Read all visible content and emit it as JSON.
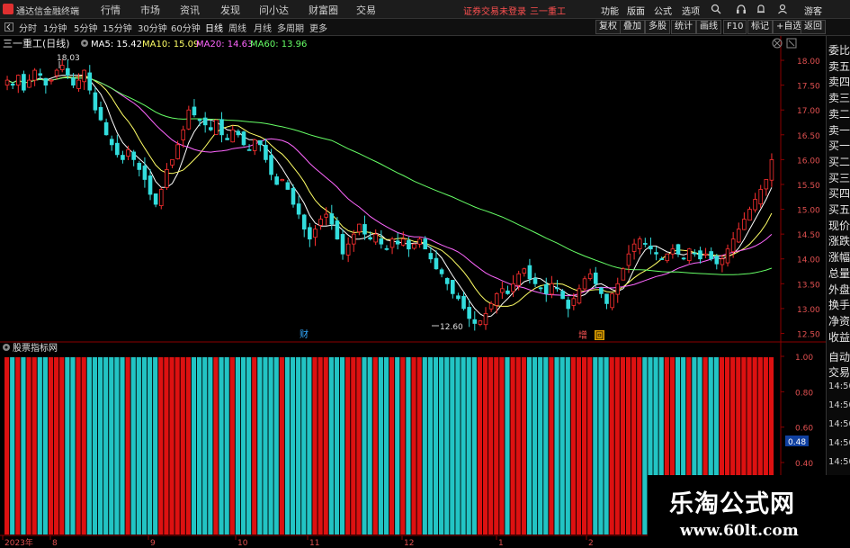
{
  "app": {
    "title": "通达信金融终端",
    "menu": [
      "行情",
      "市场",
      "资讯",
      "发现",
      "问小达",
      "财富圈",
      "交易"
    ],
    "warning": "证券交易未登录",
    "stock_name": "三一重工",
    "right_menu": [
      "功能",
      "版面",
      "公式",
      "选项"
    ],
    "guest": "游客"
  },
  "period_bar": {
    "periods": [
      "分时",
      "1分钟",
      "5分钟",
      "15分钟",
      "30分钟",
      "60分钟",
      "日线",
      "周线",
      "月线",
      "多周期",
      "更多"
    ],
    "active": "日线",
    "tools": [
      "复权",
      "叠加",
      "多股",
      "统计",
      "画线",
      "F10",
      "标记",
      "+自选",
      "返回"
    ]
  },
  "kline": {
    "title": "三一重工(日线)",
    "ma": [
      {
        "label": "MA5: 15.42",
        "color": "#ffffff"
      },
      {
        "label": "MA10: 15.09",
        "color": "#ffff66"
      },
      {
        "label": "MA20: 14.63",
        "color": "#ff66ff"
      },
      {
        "label": "MA60: 13.96",
        "color": "#66ff66"
      }
    ],
    "high_label": "18.03",
    "low_label": "12.60",
    "markers": [
      "财",
      "增",
      "回"
    ],
    "ylim": [
      12.4,
      18.2
    ],
    "yticks": [
      "18.00",
      "17.50",
      "17.00",
      "16.50",
      "16.00",
      "15.50",
      "15.00",
      "14.50",
      "14.00",
      "13.50",
      "13.00",
      "12.50"
    ]
  },
  "indicator": {
    "title": "股票指标网",
    "yticks": [
      "1.00",
      "0.80",
      "0.60",
      "0.40"
    ],
    "marker_value": "0.48"
  },
  "xaxis": {
    "labels": [
      "2023年",
      "8",
      "9",
      "10",
      "11",
      "12",
      "1",
      "2"
    ]
  },
  "right_panel": {
    "quote_items": [
      "委比",
      "卖五",
      "卖四",
      "卖三",
      "卖二",
      "卖一",
      "买一",
      "买二",
      "买三",
      "买四",
      "买五",
      "现价",
      "涨跌",
      "涨幅",
      "总量",
      "外盘",
      "换手",
      "净资",
      "收益"
    ],
    "auto_label": "自动",
    "trade_label": "交易",
    "times": [
      "14:50",
      "14:50",
      "14:50",
      "14:50",
      "14:50",
      "14:50",
      "14:50",
      "14:50"
    ]
  },
  "watermark": {
    "cn": "乐淘公式网",
    "url": "www.60lt.com"
  },
  "colors": {
    "up": "#ff3030",
    "down": "#33dddd",
    "bar_red": "#dd1111",
    "bar_cyan": "#22c4c4"
  },
  "chart_data": {
    "type": "candlestick",
    "closes": [
      17.6,
      17.5,
      17.7,
      17.4,
      17.6,
      17.8,
      17.7,
      17.5,
      17.6,
      17.8,
      17.9,
      17.7,
      17.5,
      17.6,
      17.8,
      17.4,
      17.0,
      16.8,
      16.5,
      16.3,
      16.1,
      16.0,
      16.2,
      16.0,
      15.8,
      15.6,
      15.3,
      15.1,
      15.4,
      15.8,
      16.0,
      16.3,
      16.6,
      17.0,
      16.9,
      16.8,
      16.7,
      16.6,
      16.8,
      16.5,
      16.4,
      16.6,
      16.5,
      16.3,
      16.2,
      16.4,
      16.3,
      16.0,
      15.7,
      15.5,
      15.6,
      15.4,
      15.1,
      14.9,
      14.6,
      14.4,
      14.6,
      14.8,
      14.9,
      14.7,
      14.4,
      14.1,
      14.3,
      14.5,
      14.7,
      14.5,
      14.4,
      14.5,
      14.3,
      14.2,
      14.4,
      14.3,
      14.4,
      14.2,
      14.3,
      14.4,
      14.2,
      14.0,
      13.8,
      13.7,
      13.5,
      13.3,
      13.2,
      13.0,
      12.8,
      12.7,
      12.75,
      12.9,
      13.1,
      13.3,
      13.4,
      13.3,
      13.5,
      13.7,
      13.8,
      13.6,
      13.5,
      13.4,
      13.3,
      13.5,
      13.4,
      13.2,
      13.0,
      13.2,
      13.4,
      13.6,
      13.7,
      13.5,
      13.3,
      13.1,
      13.3,
      13.5,
      13.8,
      14.1,
      14.3,
      14.4,
      14.3,
      14.2,
      14.1,
      14.0,
      14.1,
      14.2,
      14.1,
      14.0,
      14.2,
      14.1,
      14.0,
      14.1,
      14.0,
      13.9,
      14.0,
      14.2,
      14.4,
      14.6,
      14.8,
      15.0,
      15.2,
      15.4,
      15.6,
      16.0
    ]
  }
}
